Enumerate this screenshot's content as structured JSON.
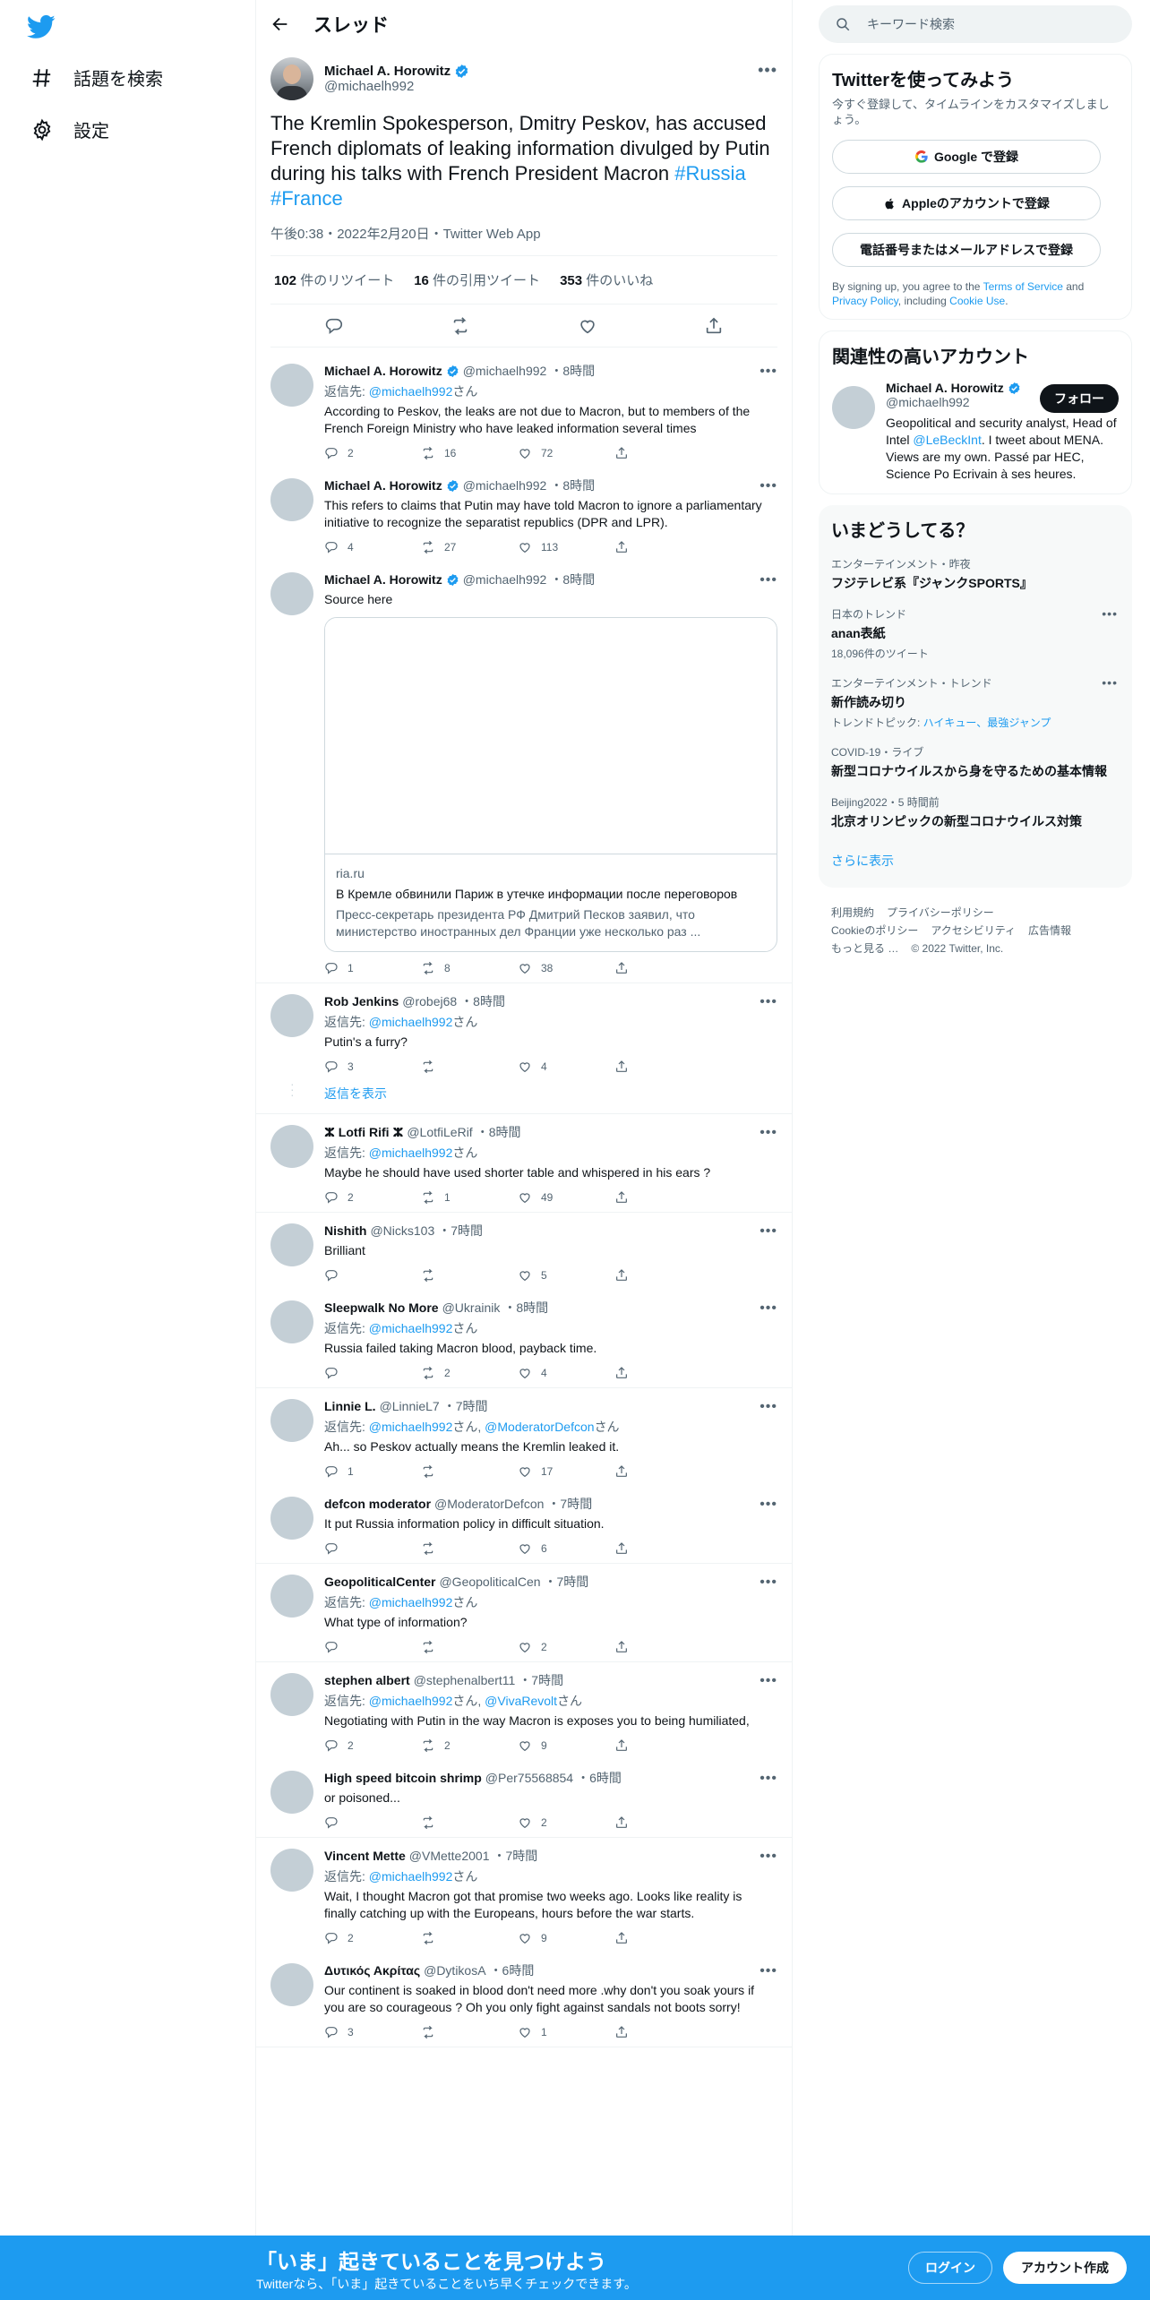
{
  "nav": {
    "explore": "話題を検索",
    "settings": "設定"
  },
  "header": {
    "title": "スレッド"
  },
  "focal": {
    "name": "Michael A. Horowitz",
    "handle": "@michaelh992",
    "text": "The Kremlin Spokesperson, Dmitry Peskov, has accused French diplomats of leaking information divulged by Putin during his talks with French President Macron ",
    "hashtag1": "#Russia",
    "hashtag2": "#France",
    "meta": "午後0:38・2022年2月20日・Twitter Web App",
    "retweets": "102",
    "retweets_label": " 件のリツイート",
    "quotes": "16",
    "quotes_label": " 件の引用ツイート",
    "likes": "353",
    "likes_label": " 件のいいね"
  },
  "reply_prefix": "返信先: ",
  "reply_suffix": "さん",
  "tweets": [
    {
      "name": "Michael A. Horowitz",
      "handle": "@michaelh992",
      "time": "・8時間",
      "reply_to": "@michaelh992",
      "text": "According to Peskov, the leaks are not due to Macron, but to members of the French Foreign Ministry who have leaked information several times",
      "replies": "2",
      "retweets": "16",
      "likes": "72"
    },
    {
      "name": "Michael A. Horowitz",
      "handle": "@michaelh992",
      "time": "・8時間",
      "text": "This refers to claims that Putin may have told Macron to ignore a parliamentary initiative to recognize the separatist republics (DPR and LPR).",
      "replies": "4",
      "retweets": "27",
      "likes": "113"
    },
    {
      "name": "Michael A. Horowitz",
      "handle": "@michaelh992",
      "time": "・8時間",
      "text": "Source here",
      "card": {
        "domain": "ria.ru",
        "title": "В Кремле обвинили Париж в утечке информации после переговоров",
        "desc": "Пресс-секретарь президента РФ Дмитрий Песков заявил, что министерство иностранных дел Франции уже несколько раз ..."
      },
      "replies": "1",
      "retweets": "8",
      "likes": "38"
    },
    {
      "name": "Rob Jenkins",
      "handle": "@robej68",
      "time": "・8時間",
      "reply_to": "@michaelh992",
      "text": "Putin's a furry?",
      "replies": "3",
      "retweets": "",
      "likes": "4"
    },
    {
      "name": "ⵣ Lotfi Rifi ⵣ",
      "handle": "@LotfiLeRif",
      "time": "・8時間",
      "reply_to": "@michaelh992",
      "text": "Maybe he should have used shorter table and whispered in his ears ?",
      "replies": "2",
      "retweets": "1",
      "likes": "49"
    },
    {
      "name": "Nishith",
      "handle": "@Nicks103",
      "time": "・7時間",
      "text": "Brilliant",
      "replies": "",
      "retweets": "",
      "likes": "5"
    },
    {
      "name": "Sleepwalk No More",
      "handle": "@Ukrainik",
      "time": "・8時間",
      "reply_to": "@michaelh992",
      "text": "Russia failed taking Macron blood, payback time.",
      "replies": "",
      "retweets": "2",
      "likes": "4"
    },
    {
      "name": "Linnie L.",
      "handle": "@LinnieL7",
      "time": "・7時間",
      "reply_to": "@michaelh992",
      "reply_to2": "@ModeratorDefcon",
      "text": "Ah... so Peskov actually means the Kremlin leaked it.",
      "replies": "1",
      "retweets": "",
      "likes": "17"
    },
    {
      "name": "defcon moderator",
      "handle": "@ModeratorDefcon",
      "time": "・7時間",
      "text": "It put Russia  information  policy in difficult  situation.",
      "replies": "",
      "retweets": "",
      "likes": "6"
    },
    {
      "name": "GeopoliticalCenter",
      "handle": "@GeopoliticalCen",
      "time": "・7時間",
      "reply_to": "@michaelh992",
      "text": "What type of information?",
      "replies": "",
      "retweets": "",
      "likes": "2"
    },
    {
      "name": "stephen albert",
      "handle": "@stephenalbert11",
      "time": "・7時間",
      "reply_to": "@michaelh992",
      "reply_to2": "@VivaRevolt",
      "text": "Negotiating with Putin in the way Macron is exposes you to being humiliated,",
      "replies": "2",
      "retweets": "2",
      "likes": "9"
    },
    {
      "name": "High speed bitcoin shrimp",
      "handle": "@Per75568854",
      "time": "・6時間",
      "text": "or poisoned...",
      "replies": "",
      "retweets": "",
      "likes": "2"
    },
    {
      "name": "Vincent Mette",
      "handle": "@VMette2001",
      "time": "・7時間",
      "reply_to": "@michaelh992",
      "text": "Wait, I thought Macron got that promise two weeks ago. Looks like reality is finally catching up with the Europeans, hours before the war starts.",
      "replies": "2",
      "retweets": "",
      "likes": "9"
    },
    {
      "name": "Δυτικός Ακρίτας",
      "handle": "@DytikosA",
      "time": "・6時間",
      "text": "Our continent is soaked in blood don't need more .why don't you soak yours if you are so courageous ? Oh you only fight against sandals not boots sorry!",
      "replies": "3",
      "retweets": "",
      "likes": "1"
    }
  ],
  "show_replies": "返信を表示",
  "search": {
    "placeholder": "キーワード検索"
  },
  "signup": {
    "title": "Twitterを使ってみよう",
    "sub": "今すぐ登録して、タイムラインをカスタマイズしましょう。",
    "google": "Google で登録",
    "apple": "Appleのアカウントで登録",
    "phone": "電話番号またはメールアドレスで登録",
    "legal_1": "By signing up, you agree to the ",
    "legal_tos": "Terms of Service",
    "legal_2": " and ",
    "legal_pp": "Privacy Policy",
    "legal_3": ", including ",
    "legal_cookie": "Cookie Use",
    "legal_4": "."
  },
  "relevant": {
    "title": "関連性の高いアカウント",
    "name": "Michael A. Horowitz",
    "handle": "@michaelh992",
    "follow": "フォロー",
    "bio_1": "Geopolitical and security analyst, Head of Intel ",
    "bio_link": "@LeBeckInt",
    "bio_2": ". I tweet about MENA. Views are my own. Passé par HEC, Science Po Ecrivain à ses heures."
  },
  "trends": {
    "title": "いまどうしてる？",
    "items": [
      {
        "ctx": "エンターテインメント・昨夜",
        "name": "フジテレビ系『ジャンクSPORTS』",
        "count": ""
      },
      {
        "ctx": "日本のトレンド",
        "name": "anan表紙",
        "count": "18,096件のツイート"
      },
      {
        "ctx": "エンターテインメント・トレンド",
        "name": "新作読み切り",
        "count_prefix": "トレンドトピック: ",
        "count_links": "ハイキュー、最強ジャンプ"
      },
      {
        "ctx": "COVID-19・ライブ",
        "name": "新型コロナウイルスから身を守るための基本情報",
        "count": ""
      },
      {
        "ctx": "Beijing2022・5 時間前",
        "name": "北京オリンピックの新型コロナウイルス対策",
        "count": ""
      }
    ],
    "show_more": "さらに表示"
  },
  "footer": {
    "l1": "利用規約",
    "l2": "プライバシーポリシー",
    "l3": "Cookieのポリシー",
    "l4": "アクセシビリティ",
    "l5": "広告情報",
    "l6": "もっと見る …",
    "l7": "© 2022 Twitter, Inc."
  },
  "bottom": {
    "title": "「いま」起きていることを見つけよう",
    "sub": "Twitterなら、「いま」起きていることをいち早くチェックできます。",
    "login": "ログイン",
    "signup": "アカウント作成"
  },
  "colors": {
    "accent": "#1d9bf0",
    "text": "#0f1419",
    "muted": "#536471"
  }
}
